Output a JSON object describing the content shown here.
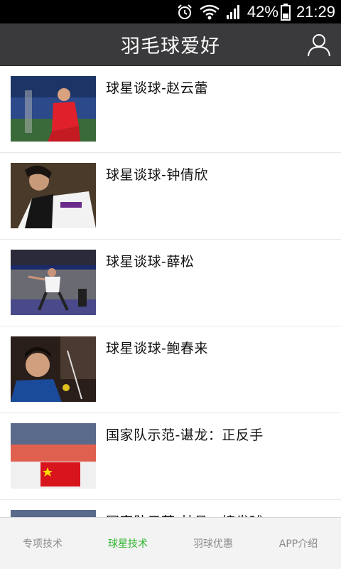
{
  "status_bar": {
    "battery_percent": "42%",
    "time": "21:29",
    "icons": [
      "alarm-icon",
      "wifi-icon",
      "signal-icon",
      "battery-icon"
    ]
  },
  "header": {
    "title": "羽毛球爱好",
    "user_icon": "user-icon"
  },
  "list": {
    "items": [
      {
        "title": "球星谈球-赵云蕾"
      },
      {
        "title": "球星谈球-钟倩欣"
      },
      {
        "title": "球星谈球-薛松"
      },
      {
        "title": "球星谈球-鲍春来"
      },
      {
        "title": "国家队示范-谌龙：正反手"
      },
      {
        "title": "国家队示范-林丹：接发球"
      }
    ]
  },
  "tabbar": {
    "tabs": [
      {
        "label": "专项技术"
      },
      {
        "label": "球星技术"
      },
      {
        "label": "羽球优惠"
      },
      {
        "label": "APP介绍"
      }
    ],
    "active_color": "#2cb42c"
  }
}
